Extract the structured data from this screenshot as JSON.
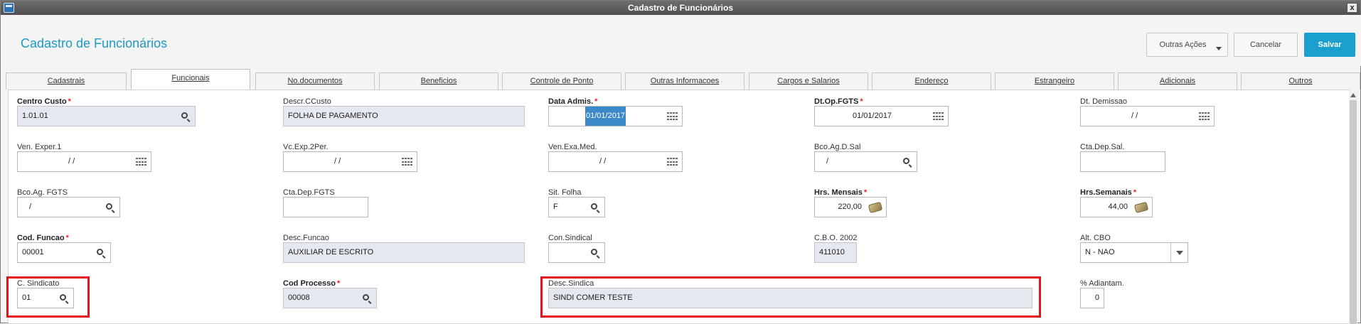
{
  "window": {
    "title": "Cadastro de Funcionários",
    "close_symbol": "x"
  },
  "header": {
    "title": "Cadastro de Funcionários",
    "outras_acoes": "Outras Ações",
    "cancelar": "Cancelar",
    "salvar": "Salvar",
    "accent_color": "#1b9fcf"
  },
  "tabs": [
    {
      "label": "Cadastrais",
      "active": false
    },
    {
      "label": "Funcionais",
      "active": true
    },
    {
      "label": "No.documentos",
      "active": false
    },
    {
      "label": "Beneficios",
      "active": false
    },
    {
      "label": "Controle de Ponto",
      "active": false
    },
    {
      "label": "Outras Informacoes",
      "active": false
    },
    {
      "label": "Cargos e Salarios",
      "active": false
    },
    {
      "label": "Endereço",
      "active": false
    },
    {
      "label": "Estrangeiro",
      "active": false
    },
    {
      "label": "Adicionais",
      "active": false
    },
    {
      "label": "Outros",
      "active": false
    }
  ],
  "form": {
    "centro_custo": {
      "label": "Centro Custo",
      "value": "1.01.01"
    },
    "desc_ccusto": {
      "label": "Descr.CCusto",
      "value": "FOLHA DE PAGAMENTO"
    },
    "data_admis": {
      "label": "Data Admis.",
      "value": "01/01/2017"
    },
    "dt_op_fgts": {
      "label": "Dt.Op.FGTS",
      "value": "01/01/2017"
    },
    "dt_demissao": {
      "label": "Dt. Demissao",
      "value": "/ /"
    },
    "ven_exper1": {
      "label": "Ven. Exper.1",
      "value": "/ /"
    },
    "vc_exp_2per": {
      "label": "Vc.Exp.2Per.",
      "value": "/ /"
    },
    "ven_exa_med": {
      "label": "Ven.Exa.Med.",
      "value": "/ /"
    },
    "bco_ag_d_sal": {
      "label": "Bco.Ag.D.Sal",
      "value": "/"
    },
    "cta_dep_sal": {
      "label": "Cta.Dep.Sal.",
      "value": ""
    },
    "bco_ag_fgts": {
      "label": "Bco.Ag. FGTS",
      "value": "/"
    },
    "cta_dep_fgts": {
      "label": "Cta.Dep.FGTS",
      "value": ""
    },
    "sit_folha": {
      "label": "Sit. Folha",
      "value": "F"
    },
    "hrs_mensais": {
      "label": "Hrs. Mensais",
      "value": "220,00"
    },
    "hrs_semanais": {
      "label": "Hrs.Semanais",
      "value": "44,00"
    },
    "cod_funcao": {
      "label": "Cod. Funcao",
      "value": "00001"
    },
    "desc_funcao": {
      "label": "Desc.Funcao",
      "value": "AUXILIAR DE ESCRITO"
    },
    "con_sindical": {
      "label": "Con.Sindical",
      "value": ""
    },
    "cbo_2002": {
      "label": "C.B.O. 2002",
      "value": "411010"
    },
    "alt_cbo": {
      "label": "Alt. CBO",
      "value": "N - NAO"
    },
    "c_sindicato": {
      "label": "C. Sindicato",
      "value": "01"
    },
    "cod_processo": {
      "label": "Cod Processo",
      "value": "00008"
    },
    "desc_sindica": {
      "label": "Desc.Sindica",
      "value": "SINDI COMER TESTE"
    },
    "pct_adiantam": {
      "label": "% Adiantam.",
      "value": "0"
    }
  },
  "colors": {
    "required_star": "#e0262e",
    "highlight": "#e3141a",
    "readonly_bg": "#e5e8ee"
  }
}
